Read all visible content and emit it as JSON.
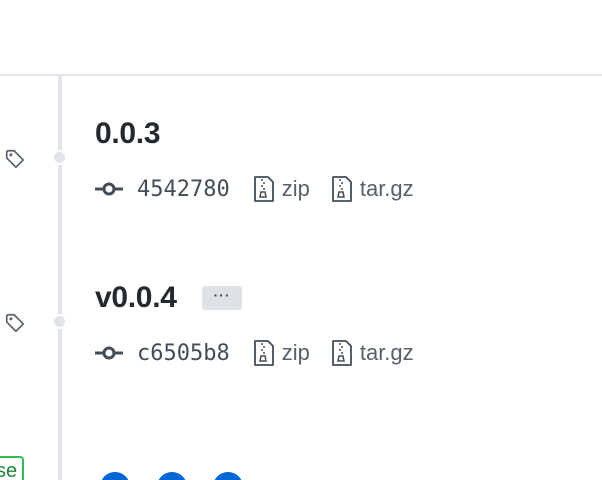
{
  "releases": [
    {
      "title": "0.0.3",
      "commit": "4542780",
      "assets": [
        {
          "label": "zip",
          "icon": "file-zip-icon"
        },
        {
          "label": "tar.gz",
          "icon": "file-zip-icon"
        }
      ],
      "has_menu": false
    },
    {
      "title": "v0.0.4",
      "menu_label": "···",
      "commit": "c6505b8",
      "assets": [
        {
          "label": "zip",
          "icon": "file-zip-icon"
        },
        {
          "label": "tar.gz",
          "icon": "file-zip-icon"
        }
      ],
      "has_menu": true
    }
  ],
  "partial_badge": "se",
  "colors": {
    "timeline": "#e1e4e8",
    "title": "#24292e",
    "muted": "#586069",
    "badge_green": "#2cbe4e",
    "avatar_blue": "#0366d6"
  }
}
